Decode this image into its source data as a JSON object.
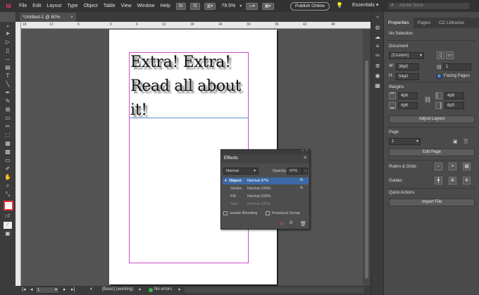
{
  "menubar": {
    "app_logo": "Id",
    "items": [
      "File",
      "Edit",
      "Layout",
      "Type",
      "Object",
      "Table",
      "View",
      "Window",
      "Help"
    ],
    "badge_br": "Br",
    "badge_st": "St",
    "zoom": "79.5%",
    "publish_label": "Publish Online",
    "workspace": "Essentials",
    "workspace_chevron": "▾",
    "search_placeholder": "Adobe Stock"
  },
  "document_tab": {
    "title": "*Untitled-1 @ 80%",
    "close": "×"
  },
  "ruler": {
    "labels": [
      "18",
      "12",
      "6",
      "0",
      "6",
      "12",
      "18",
      "24",
      "30",
      "36",
      "42",
      "48"
    ]
  },
  "canvas": {
    "headline": "Extra! Extra! Read all about it!"
  },
  "statusbar": {
    "page": "1",
    "style": "[Basic] (working)",
    "errors": "No errors"
  },
  "properties": {
    "tabs": [
      "Properties",
      "Pages",
      "CC Libraries"
    ],
    "selection": "No Selection",
    "document_label": "Document",
    "preset": "[Custom]",
    "w_label": "W:",
    "w_value": "36p0",
    "h_label": "H:",
    "h_value": "54p0",
    "pages_value": "1",
    "facing_pages": "Facing Pages",
    "margins_label": "Margins",
    "margin_top": "4p6",
    "margin_bottom": "4p6",
    "margin_inside": "4p6",
    "margin_outside": "6p0",
    "adjust_layout": "Adjust Layout",
    "page_label": "Page",
    "page_value": "1",
    "edit_page": "Edit Page",
    "rulers_grids": "Rulers & Grids",
    "guides": "Guides",
    "quick_actions": "Quick Actions",
    "import_file": "Import File"
  },
  "effects": {
    "title": "Effects",
    "mode": "Normal",
    "opacity_label": "Opacity:",
    "opacity_value": "47%",
    "rows": [
      {
        "label": "Object:",
        "value": "Normal 47%"
      },
      {
        "label": "Stroke:",
        "value": "Normal 100%"
      },
      {
        "label": "Fill:",
        "value": "Normal 100%"
      },
      {
        "label": "Text:",
        "value": "Normal 100%"
      }
    ],
    "isolate": "Isolate Blending",
    "knockout": "Knockout Group",
    "fx": "fx"
  }
}
